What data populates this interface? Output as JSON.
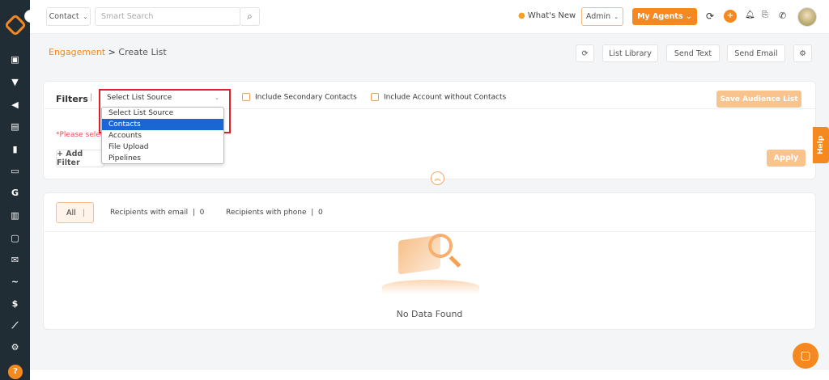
{
  "topbar": {
    "module_select": "Contact",
    "search_placeholder": "Smart Search",
    "whats_new": "What's New",
    "role_select": "Admin",
    "my_agents": "My Agents"
  },
  "breadcrumb": {
    "parent": "Engagement",
    "separator": ">",
    "current": "Create List"
  },
  "actions": {
    "list_library": "List Library",
    "send_text": "Send Text",
    "send_email": "Send Email"
  },
  "filters": {
    "label": "Filters",
    "source_select": "Select List Source",
    "options": [
      "Select List Source",
      "Contacts",
      "Accounts",
      "File Upload",
      "Pipelines"
    ],
    "selected_option": "Contacts",
    "include_secondary": "Include Secondary Contacts",
    "include_accounts": "Include Account without Contacts",
    "save_audience": "Save Audience List",
    "warning": "*Please selec",
    "add_filter": "+ Add Filter",
    "apply": "Apply"
  },
  "results": {
    "tab_all": "All",
    "email_label": "Recipients with email",
    "email_count": "0",
    "phone_label": "Recipients with phone",
    "phone_count": "0",
    "empty": "No Data Found"
  },
  "help": "Help",
  "colors": {
    "accent": "#f5891f",
    "sidebar": "#212d35",
    "highlight": "#1a66d2",
    "red_outline": "#e0202a"
  }
}
